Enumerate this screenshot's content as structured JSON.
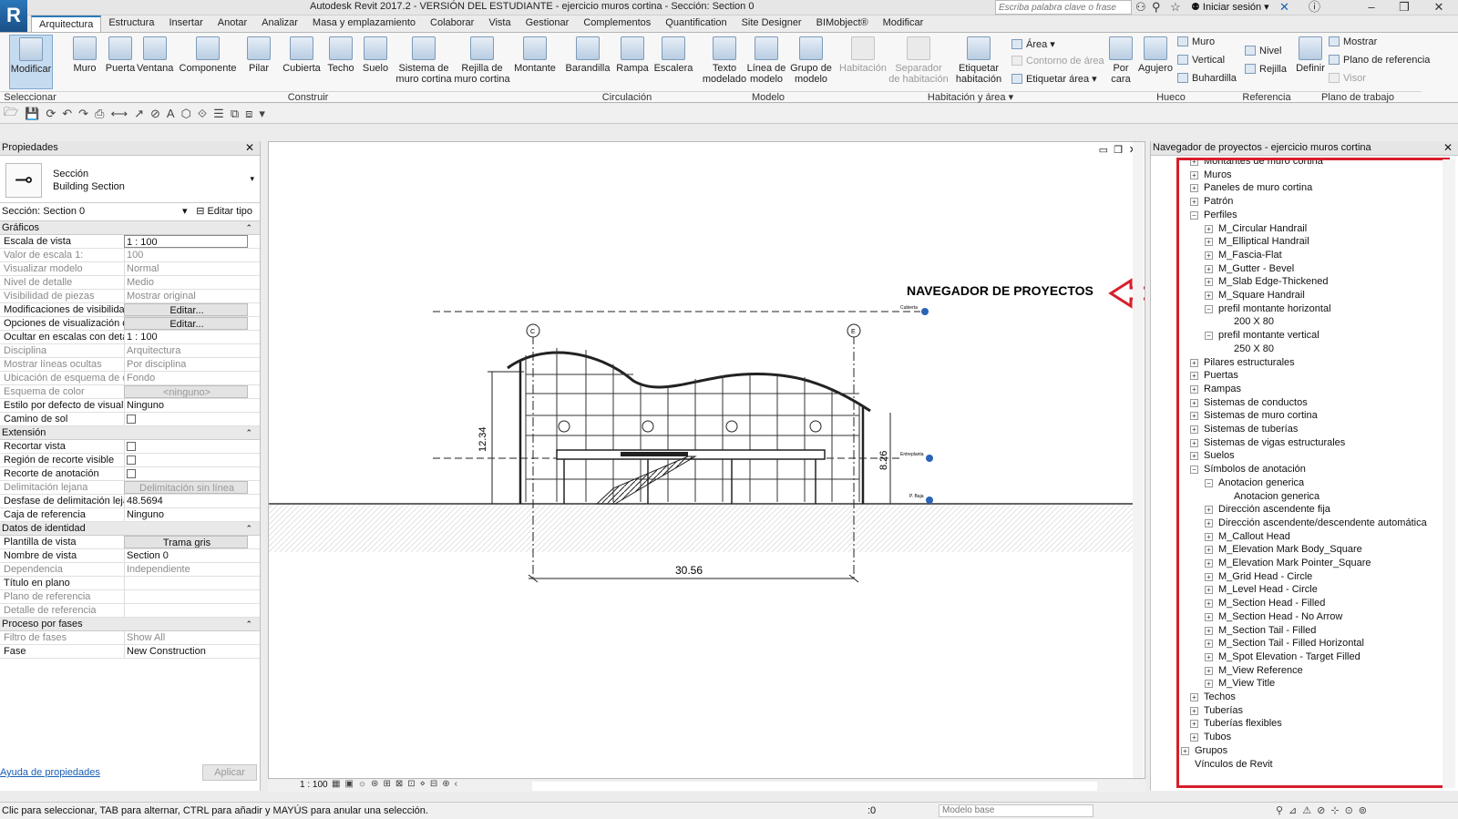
{
  "titlebar": {
    "title": "Autodesk Revit 2017.2 - VERSIÓN DEL ESTUDIANTE -    ejercicio muros cortina - Sección: Section 0",
    "search_placeholder": "Escriba palabra clave o frase",
    "login": "Iniciar sesión",
    "logo": "R"
  },
  "tabs": [
    "Arquitectura",
    "Estructura",
    "Insertar",
    "Anotar",
    "Analizar",
    "Masa y emplazamiento",
    "Colaborar",
    "Vista",
    "Gestionar",
    "Complementos",
    "Quantification",
    "Site Designer",
    "BIMobject®",
    "Modificar"
  ],
  "ribbon": {
    "tools": {
      "modify": "Modificar",
      "wall": "Muro",
      "door": "Puerta",
      "window": "Ventana",
      "component": "Componente",
      "column": "Pilar",
      "roof": "Cubierta",
      "ceiling": "Techo",
      "floor": "Suelo",
      "curtain_system": "Sistema de\nmuro cortina",
      "curtain_grid": "Rejilla de\nmuro cortina",
      "mullion": "Montante",
      "railing": "Barandilla",
      "ramp": "Rampa",
      "stair": "Escalera",
      "model_text": "Texto\nmodelado",
      "model_line": "Línea de\nmodelo",
      "model_group": "Grupo de\nmodelo",
      "room": "Habitación",
      "room_separator": "Separador\nde habitación",
      "tag_room": "Etiquetar\nhabitación",
      "by_face": "Por\ncara",
      "shaft": "Agujero",
      "set": "Definir"
    },
    "small": {
      "area": "Área",
      "area_boundary": "Contorno de área",
      "tag_area": "Etiquetar área",
      "wall_op": "Muro",
      "vertical": "Vertical",
      "dormer": "Buhardilla",
      "level": "Nivel",
      "grid": "Rejilla",
      "show": "Mostrar",
      "ref_plane": "Plano de referencia",
      "viewer": "Visor"
    },
    "panels": {
      "select": "Seleccionar",
      "build": "Construir",
      "circulation": "Circulación",
      "model": "Modelo",
      "room_area": "Habitación y área",
      "opening": "Hueco",
      "datum": "Referencia",
      "work_plane": "Plano de trabajo"
    }
  },
  "properties": {
    "title": "Propiedades",
    "type_line1": "Sección",
    "type_line2": "Building Section",
    "instance": "Sección: Section 0",
    "edit_type": "Editar tipo",
    "sections": [
      {
        "name": "Gráficos",
        "rows": [
          {
            "k": "Escala de vista",
            "v": "1 : 100",
            "style": "boxed"
          },
          {
            "k": "Valor de escala    1:",
            "v": "100",
            "g": true
          },
          {
            "k": "Visualizar modelo",
            "v": "Normal",
            "g": true
          },
          {
            "k": "Nivel de detalle",
            "v": "Medio",
            "g": true
          },
          {
            "k": "Visibilidad de piezas",
            "v": "Mostrar original",
            "g": true
          },
          {
            "k": "Modificaciones de visibilida...",
            "v": "Editar...",
            "style": "btn"
          },
          {
            "k": "Opciones de visualización d...",
            "v": "Editar...",
            "style": "btn"
          },
          {
            "k": "Ocultar en escalas con detal...",
            "v": "1 : 100"
          },
          {
            "k": "Disciplina",
            "v": "Arquitectura",
            "g": true
          },
          {
            "k": "Mostrar líneas ocultas",
            "v": "Por disciplina",
            "g": true
          },
          {
            "k": "Ubicación de esquema de c...",
            "v": "Fondo",
            "g": true
          },
          {
            "k": "Esquema de color",
            "v": "<ninguno>",
            "g": true,
            "style": "btn"
          },
          {
            "k": "Estilo por defecto de visualiz...",
            "v": "Ninguno"
          },
          {
            "k": "Camino de sol",
            "v": "",
            "style": "check"
          }
        ]
      },
      {
        "name": "Extensión",
        "rows": [
          {
            "k": "Recortar vista",
            "v": "",
            "style": "check"
          },
          {
            "k": "Región de recorte visible",
            "v": "",
            "style": "check"
          },
          {
            "k": "Recorte de anotación",
            "v": "",
            "style": "check"
          },
          {
            "k": "Delimitación lejana",
            "v": "Delimitación sin línea",
            "g": true,
            "style": "btn"
          },
          {
            "k": "Desfase de delimitación leja...",
            "v": "48.5694"
          },
          {
            "k": "Caja de referencia",
            "v": "Ninguno"
          }
        ]
      },
      {
        "name": "Datos de identidad",
        "rows": [
          {
            "k": "Plantilla de vista",
            "v": "Trama gris",
            "style": "btn"
          },
          {
            "k": "Nombre de vista",
            "v": "Section 0"
          },
          {
            "k": "Dependencia",
            "v": "Independiente",
            "g": true
          },
          {
            "k": "Título en plano",
            "v": ""
          },
          {
            "k": "Plano de referencia",
            "v": "",
            "g": true
          },
          {
            "k": "Detalle de referencia",
            "v": "",
            "g": true
          }
        ]
      },
      {
        "name": "Proceso por fases",
        "rows": [
          {
            "k": "Filtro de fases",
            "v": "Show All",
            "g": true
          },
          {
            "k": "Fase",
            "v": "New Construction"
          }
        ]
      }
    ],
    "help": "Ayuda de propiedades",
    "apply": "Aplicar"
  },
  "view": {
    "annotation": "NAVEGADOR DE PROYECTOS",
    "dim_height": "12.34",
    "dim_height2": "8.26",
    "dim_width": "30.56",
    "grid_c": "C",
    "grid_e": "E",
    "level_top": "Cubierta",
    "level_mid": "Entreplanta",
    "level_bot": "P. Baja",
    "scale": "1 : 100"
  },
  "browser": {
    "title": "Navegador de proyectos - ejercicio muros cortina",
    "nodes": [
      {
        "t": "Montantes de muro cortina",
        "l": 1,
        "e": "+"
      },
      {
        "t": "Muros",
        "l": 1,
        "e": "+"
      },
      {
        "t": "Paneles de muro cortina",
        "l": 1,
        "e": "+"
      },
      {
        "t": "Patrón",
        "l": 1,
        "e": "+"
      },
      {
        "t": "Perfiles",
        "l": 1,
        "e": "-"
      },
      {
        "t": "M_Circular Handrail",
        "l": 2,
        "e": "+"
      },
      {
        "t": "M_Elliptical Handrail",
        "l": 2,
        "e": "+"
      },
      {
        "t": "M_Fascia-Flat",
        "l": 2,
        "e": "+"
      },
      {
        "t": "M_Gutter - Bevel",
        "l": 2,
        "e": "+"
      },
      {
        "t": "M_Slab Edge-Thickened",
        "l": 2,
        "e": "+"
      },
      {
        "t": "M_Square Handrail",
        "l": 2,
        "e": "+"
      },
      {
        "t": "prefil montante horizontal",
        "l": 2,
        "e": "-"
      },
      {
        "t": "200 X 80",
        "l": 3,
        "e": ""
      },
      {
        "t": "prefil montante vertical",
        "l": 2,
        "e": "-"
      },
      {
        "t": "250 X 80",
        "l": 3,
        "e": ""
      },
      {
        "t": "Pilares estructurales",
        "l": 1,
        "e": "+"
      },
      {
        "t": "Puertas",
        "l": 1,
        "e": "+"
      },
      {
        "t": "Rampas",
        "l": 1,
        "e": "+"
      },
      {
        "t": "Sistemas de conductos",
        "l": 1,
        "e": "+"
      },
      {
        "t": "Sistemas de muro cortina",
        "l": 1,
        "e": "+"
      },
      {
        "t": "Sistemas de tuberías",
        "l": 1,
        "e": "+"
      },
      {
        "t": "Sistemas de vigas estructurales",
        "l": 1,
        "e": "+"
      },
      {
        "t": "Suelos",
        "l": 1,
        "e": "+"
      },
      {
        "t": "Símbolos de anotación",
        "l": 1,
        "e": "-"
      },
      {
        "t": "Anotacion generica",
        "l": 2,
        "e": "-"
      },
      {
        "t": "Anotacion generica",
        "l": 3,
        "e": ""
      },
      {
        "t": "Dirección ascendente fija",
        "l": 2,
        "e": "+"
      },
      {
        "t": "Dirección ascendente/descendente automática",
        "l": 2,
        "e": "+"
      },
      {
        "t": "M_Callout Head",
        "l": 2,
        "e": "+"
      },
      {
        "t": "M_Elevation Mark Body_Square",
        "l": 2,
        "e": "+"
      },
      {
        "t": "M_Elevation Mark Pointer_Square",
        "l": 2,
        "e": "+"
      },
      {
        "t": "M_Grid Head - Circle",
        "l": 2,
        "e": "+"
      },
      {
        "t": "M_Level Head - Circle",
        "l": 2,
        "e": "+"
      },
      {
        "t": "M_Section Head - Filled",
        "l": 2,
        "e": "+"
      },
      {
        "t": "M_Section Head - No Arrow",
        "l": 2,
        "e": "+"
      },
      {
        "t": "M_Section Tail - Filled",
        "l": 2,
        "e": "+"
      },
      {
        "t": "M_Section Tail - Filled Horizontal",
        "l": 2,
        "e": "+"
      },
      {
        "t": "M_Spot Elevation - Target Filled",
        "l": 2,
        "e": "+"
      },
      {
        "t": "M_View Reference",
        "l": 2,
        "e": "+"
      },
      {
        "t": "M_View Title",
        "l": 2,
        "e": "+"
      },
      {
        "t": "Techos",
        "l": 1,
        "e": "+"
      },
      {
        "t": "Tuberías",
        "l": 1,
        "e": "+"
      },
      {
        "t": "Tuberías flexibles",
        "l": 1,
        "e": "+"
      },
      {
        "t": "Tubos",
        "l": 1,
        "e": "+"
      },
      {
        "t": "Grupos",
        "l": 0,
        "e": "+"
      },
      {
        "t": "Vínculos de Revit",
        "l": 0,
        "e": ""
      }
    ]
  },
  "status": {
    "text": "Clic para seleccionar, TAB para alternar, CTRL para añadir y MAYÚS para anular una selección.",
    "workset": "Modelo base",
    "zero": ":0"
  }
}
